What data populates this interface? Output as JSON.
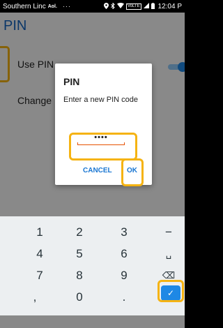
{
  "status_bar": {
    "carrier": "Southern Linc",
    "carrier_badge": "Aol.",
    "overflow": "···",
    "icons": [
      "location-icon",
      "bluetooth-icon",
      "wifi-icon",
      "lte-icon",
      "signal-icon",
      "battery-icon"
    ],
    "lte_label": "VoLTE",
    "time": "12:04 P"
  },
  "app": {
    "title": "PIN",
    "settings": [
      {
        "label": "Use PIN",
        "toggle_on": true
      },
      {
        "label": "Change"
      }
    ]
  },
  "dialog": {
    "title": "PIN",
    "message": "Enter a new PIN code",
    "pin_value": "••••",
    "cancel_label": "CANCEL",
    "ok_label": "OK"
  },
  "keyboard": {
    "keys": [
      [
        "1",
        "2",
        "3",
        "−"
      ],
      [
        "4",
        "5",
        "6",
        "␣"
      ],
      [
        "7",
        "8",
        "9",
        "⌫"
      ],
      [
        ",",
        "0",
        ".",
        "✓"
      ]
    ]
  },
  "colors": {
    "accent": "#1565c0",
    "highlight": "#f5b312",
    "input_line": "#e65100"
  }
}
